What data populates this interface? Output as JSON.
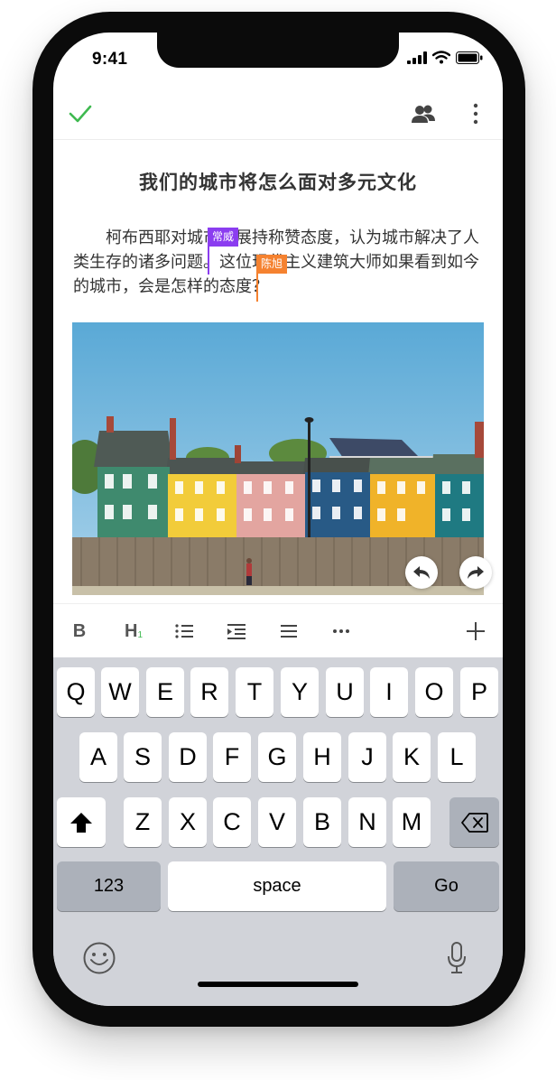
{
  "status_bar": {
    "time": "9:41"
  },
  "document": {
    "title": "我们的城市将怎么面对多元文化",
    "paragraph": "柯布西耶对城市发展持称赞态度，认为城市解决了人类生存的诸多问题。这位现代主义建筑大师如果看到如今的城市，会是怎样的态度？"
  },
  "collaborators": [
    {
      "name": "常威",
      "color": "#8b3df0"
    },
    {
      "name": "陈旭",
      "color": "#f58230"
    }
  ],
  "format_toolbar": {
    "bold": "B",
    "heading": "H",
    "heading_level": "1"
  },
  "keyboard": {
    "row1": [
      "Q",
      "W",
      "E",
      "R",
      "T",
      "Y",
      "U",
      "I",
      "O",
      "P"
    ],
    "row2": [
      "A",
      "S",
      "D",
      "F",
      "G",
      "H",
      "J",
      "K",
      "L"
    ],
    "row3": [
      "Z",
      "X",
      "C",
      "V",
      "B",
      "N",
      "M"
    ],
    "numbers_label": "123",
    "space_label": "space",
    "go_label": "Go"
  },
  "colors": {
    "accent_green": "#3fb950",
    "keyboard_bg": "#d1d3d9"
  }
}
